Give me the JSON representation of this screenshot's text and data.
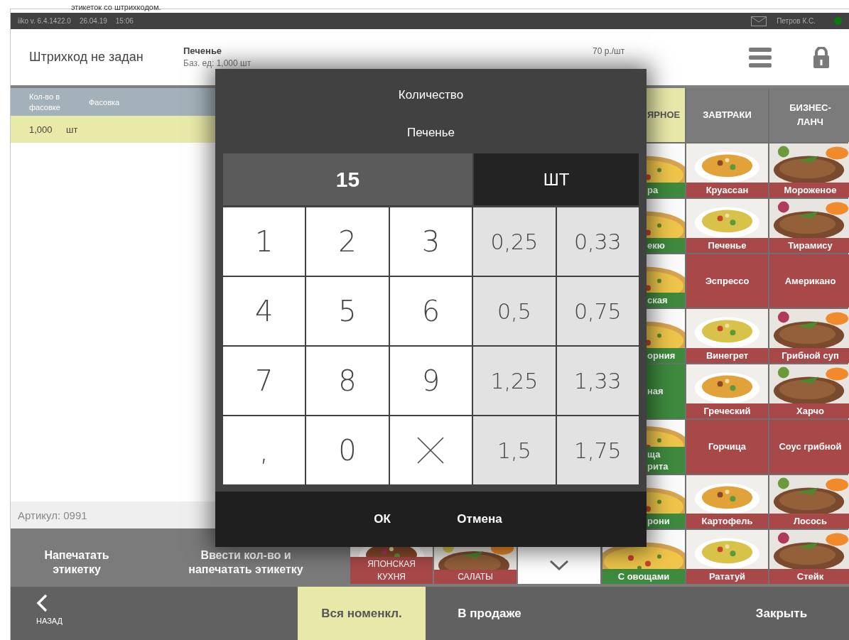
{
  "caption": "этикеток со штрихкодом.",
  "status_bar": {
    "app": "iiko  v. 6.4.1422.0",
    "date": "26.04.19",
    "time": "15:06",
    "user": "Петров К.С.",
    "online": true
  },
  "header": {
    "barcode": "Штрихкод не задан",
    "product": "Печенье",
    "base_unit": "Баз. ед: 1,000 шт",
    "price": "70 р./шт"
  },
  "packages": {
    "columns": [
      "Кол-во в фасовке",
      "Фасовка"
    ],
    "rows": [
      {
        "cells": [
          "1,000",
          "шт"
        ],
        "selected": true
      }
    ]
  },
  "article": "Артикул: 0991",
  "actions": [
    "Напечатать этикетку",
    "Ввести кол-во и напечатать этикетку"
  ],
  "groups": [
    {
      "label": "ЯПОНСКАЯ КУХНЯ"
    },
    {
      "label": "САЛАТЫ"
    },
    {
      "kind": "more"
    }
  ],
  "category_tabs": [
    {
      "label": "ЯРНОЕ",
      "selected": true
    },
    {
      "label": "ЗАВТРАКИ",
      "selected": false
    },
    {
      "label": "БИЗНЕС-ЛАНЧ",
      "selected": false
    }
  ],
  "menu_items": [
    {
      "label": "ра",
      "color": "#3e8a3e"
    },
    {
      "label": "Круассан",
      "color": "#a94848"
    },
    {
      "label": "Мороженое",
      "color": "#a94848"
    },
    {
      "label": "екю",
      "color": "#3e8a3e"
    },
    {
      "label": "Печенье",
      "color": "#a94848"
    },
    {
      "label": "Тирамису",
      "color": "#a94848"
    },
    {
      "label": "ская",
      "color": "#3e8a3e"
    },
    {
      "label": "Эспрессо",
      "kind": "plain",
      "color": "#a94848"
    },
    {
      "label": "Американо",
      "kind": "plain",
      "color": "#a94848"
    },
    {
      "label": "орния",
      "color": "#3e8a3e"
    },
    {
      "label": "Винегрет",
      "color": "#a94848"
    },
    {
      "label": "Грибной суп",
      "color": "#a94848"
    },
    {
      "label": "ная",
      "kind": "plain",
      "color": "#3e8a3e"
    },
    {
      "label": "Греческий",
      "color": "#a94848"
    },
    {
      "label": "Харчо",
      "color": "#a94848"
    },
    {
      "label": "ща\nрита",
      "color": "#3e8a3e"
    },
    {
      "label": "Горчица",
      "kind": "plain",
      "color": "#a94848"
    },
    {
      "label": "Соус грибной",
      "kind": "plain",
      "color": "#a94848"
    },
    {
      "label": "рони",
      "color": "#3e8a3e"
    },
    {
      "label": "Картофель",
      "color": "#a94848"
    },
    {
      "label": "Лосось",
      "color": "#a94848"
    },
    {
      "label": "С овощами",
      "color": "#3e8a3e"
    },
    {
      "label": "Рататуй",
      "color": "#a94848"
    },
    {
      "label": "Стейк",
      "color": "#a94848"
    }
  ],
  "footer": {
    "back": "НАЗАД",
    "filters": [
      {
        "label": "Вся номенкл.",
        "selected": true
      },
      {
        "label": "В продаже",
        "selected": false
      }
    ],
    "close": "Закрыть"
  },
  "dialog": {
    "title": "Количество",
    "product": "Печенье",
    "value": "15",
    "unit": "ШТ",
    "keys": [
      {
        "label": "1",
        "kind": "digit"
      },
      {
        "label": "2",
        "kind": "digit"
      },
      {
        "label": "3",
        "kind": "digit"
      },
      {
        "label": "0,25",
        "kind": "preset"
      },
      {
        "label": "0,33",
        "kind": "preset"
      },
      {
        "label": "4",
        "kind": "digit"
      },
      {
        "label": "5",
        "kind": "digit"
      },
      {
        "label": "6",
        "kind": "digit"
      },
      {
        "label": "0,5",
        "kind": "preset"
      },
      {
        "label": "0,75",
        "kind": "preset"
      },
      {
        "label": "7",
        "kind": "digit"
      },
      {
        "label": "8",
        "kind": "digit"
      },
      {
        "label": "9",
        "kind": "digit"
      },
      {
        "label": "1,25",
        "kind": "preset"
      },
      {
        "label": "1,33",
        "kind": "preset"
      },
      {
        "label": ",",
        "kind": "digit"
      },
      {
        "label": "0",
        "kind": "digit"
      },
      {
        "kind": "clear"
      },
      {
        "label": "1,5",
        "kind": "preset"
      },
      {
        "label": "1,75",
        "kind": "preset"
      }
    ],
    "buttons": [
      "ОК",
      "Отмена"
    ]
  }
}
